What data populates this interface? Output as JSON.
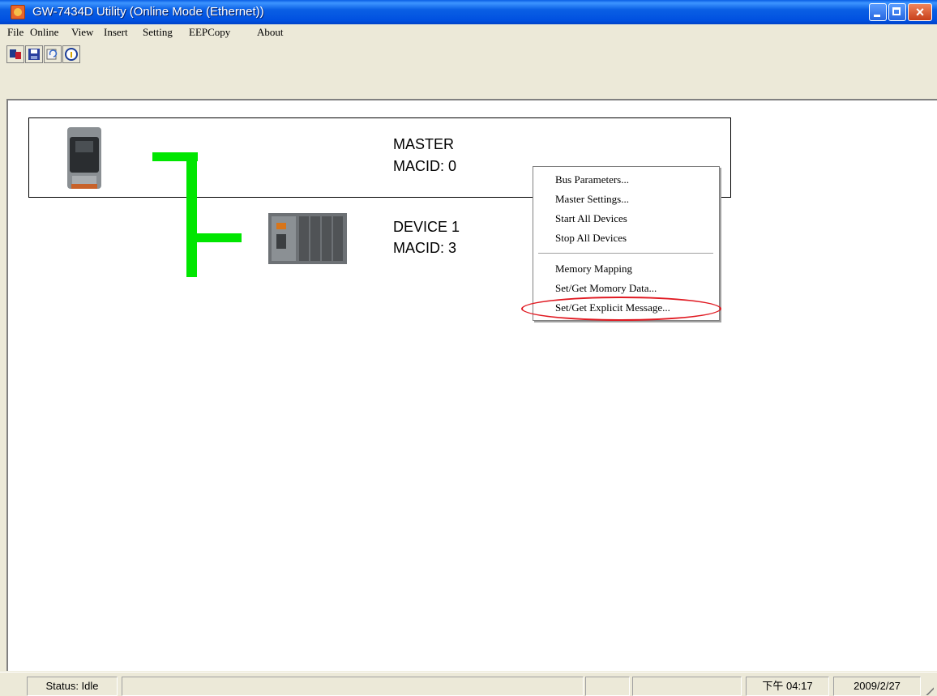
{
  "window": {
    "title": "GW-7434D Utility (Online Mode (Ethernet))"
  },
  "menubar": {
    "file": "File",
    "online": "Online",
    "view": "View",
    "insert": "Insert",
    "setting": "Setting",
    "eepcopy": "EEPCopy",
    "about": "About"
  },
  "toolbar": {
    "icons": [
      "connect-icon",
      "save-icon",
      "reload-icon",
      "info-icon"
    ]
  },
  "network": {
    "master": {
      "name": "MASTER",
      "macid": "MACID:  0"
    },
    "device1": {
      "name": "DEVICE 1",
      "macid": "MACID:   3"
    }
  },
  "context_menu": {
    "items": [
      "Bus Parameters...",
      "Master Settings...",
      "Start All Devices",
      "Stop All Devices",
      "Memory Mapping",
      "Set/Get Momory Data...",
      "Set/Get Explicit Message..."
    ],
    "highlighted_item": "Set/Get Explicit Message...",
    "highlight_color": "#e01a22"
  },
  "statusbar": {
    "status": "Status: Idle",
    "time": "下午 04:17",
    "date": "2009/2/27"
  },
  "colors": {
    "bus_line": "#00e600",
    "titlebar": "#0a5fe4"
  }
}
